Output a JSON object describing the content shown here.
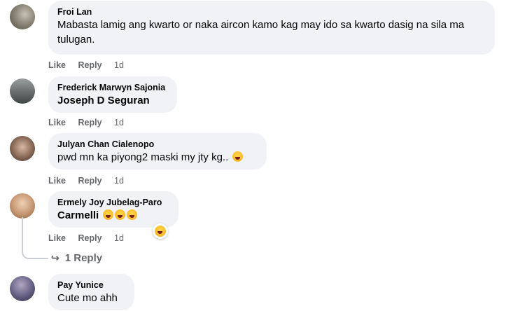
{
  "comments": [
    {
      "author": "Froi Lan",
      "text": "Mabasta lamig ang kwarto or naka aircon kamo kag may ido sa kwarto dasig na sila ma tulugan.",
      "actions": {
        "like": "Like",
        "reply": "Reply",
        "time": "1d"
      }
    },
    {
      "author": "Frederick Marwyn Sajonia",
      "text": "Joseph D Seguran",
      "actions": {
        "like": "Like",
        "reply": "Reply",
        "time": "1d"
      }
    },
    {
      "author": "Julyan Chan Cialenopo",
      "text": "pwd mn ka piyong2 maski my jty kg..",
      "actions": {
        "like": "Like",
        "reply": "Reply",
        "time": "1d"
      }
    },
    {
      "author": "Ermely Joy Jubelag-Paro",
      "text": "Carmelli",
      "actions": {
        "like": "Like",
        "reply": "Reply",
        "time": "1d"
      }
    },
    {
      "author": "Pay Yunice",
      "text": "Cute mo ahh"
    }
  ],
  "replies_link": "1 Reply",
  "icons": {
    "emoji": "laughing-crying-emoji-icon",
    "reaction": "haha-reaction-icon",
    "reply_arrow": "reply-arrow-icon"
  },
  "colors": {
    "bubble": "#f0f2f5",
    "secondary_text": "#65676b",
    "emoji": "#f7b928"
  }
}
